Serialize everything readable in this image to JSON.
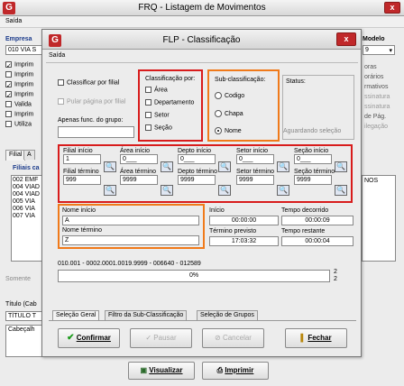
{
  "parent": {
    "title": "FRQ - Listagem de Movimentos",
    "menu": "Saída",
    "empresa_label": "Empresa",
    "empresa_value": "010 VIA S",
    "modelo_label": "Modelo",
    "modelo_value": "9",
    "checks": [
      "Imprim",
      "Imprim",
      "Imprim",
      "Imprim",
      "Valida",
      "Imprim",
      "Utiliza"
    ],
    "right_texts": [
      "oras",
      "orários",
      "rmativos",
      "ssinatura",
      "ssinatura",
      "de Pág.",
      "ilegação"
    ],
    "tabs": [
      "Filial",
      "A"
    ],
    "filiais_label": "Filiais ca",
    "filiais_items": [
      "002 EMF",
      "004 VIAD",
      "004 VIAD",
      "005 VIA",
      "006 VIA",
      "007 VIA"
    ],
    "filiais_right": "NOS",
    "somente": "Somente",
    "titulo_label": "Título (Cab",
    "titulo_value": "TÍTULO T",
    "cabecalho": "Cabeçalh",
    "visualizar": "Visualizar",
    "imprimir": "Imprimir"
  },
  "dialog": {
    "title": "FLP - Classificação",
    "menu": "Saída",
    "classificar_por_filial": "Classificar por filial",
    "pular_pagina": "Pular página por filial",
    "apenas_func": "Apenas func. do grupo:",
    "classificacao": {
      "title": "Classificação por:",
      "items": [
        "Área",
        "Departamento",
        "Setor",
        "Seção"
      ]
    },
    "subclass": {
      "title": "Sub-classificação:",
      "items": [
        "Codigo",
        "Chapa",
        "Nome"
      ],
      "selected": 2
    },
    "status_label": "Status:",
    "status_value": "Aguardando seleção",
    "ranges": [
      {
        "start_label": "Filial início",
        "start": "1",
        "end_label": "Filial término",
        "end": "999"
      },
      {
        "start_label": "Área início",
        "start": "0___",
        "end_label": "Área término",
        "end": "9999"
      },
      {
        "start_label": "Depto início",
        "start": "0___",
        "end_label": "Depto término",
        "end": "9999"
      },
      {
        "start_label": "Setor início",
        "start": "0___",
        "end_label": "Setor término",
        "end": "9999"
      },
      {
        "start_label": "Seção início",
        "start": "0___",
        "end_label": "Seção término",
        "end": "9999"
      }
    ],
    "nome_inicio_label": "Nome início",
    "nome_inicio": "A",
    "nome_termino_label": "Nome término",
    "nome_termino": "Z",
    "inicio_label": "Início",
    "inicio": "00:00:00",
    "decorrido_label": "Tempo decorrido",
    "decorrido": "00:00:09",
    "termino_label": "Término previsto",
    "termino": "17:03:32",
    "restante_label": "Tempo restante",
    "restante": "00:00:04",
    "path": "010.001 - 0002.0001.0019.9999 - 006640 - 012589",
    "progress_text": "0%",
    "progress": 0,
    "count_top": "2",
    "count_bottom": "2",
    "tabs": [
      "Seleção Geral",
      "Filtro da Sub-Classificação",
      "Seleção de Grupos"
    ],
    "buttons": {
      "confirmar": "Confirmar",
      "pausar": "Pausar",
      "cancelar": "Cancelar",
      "fechar": "Fechar"
    }
  }
}
